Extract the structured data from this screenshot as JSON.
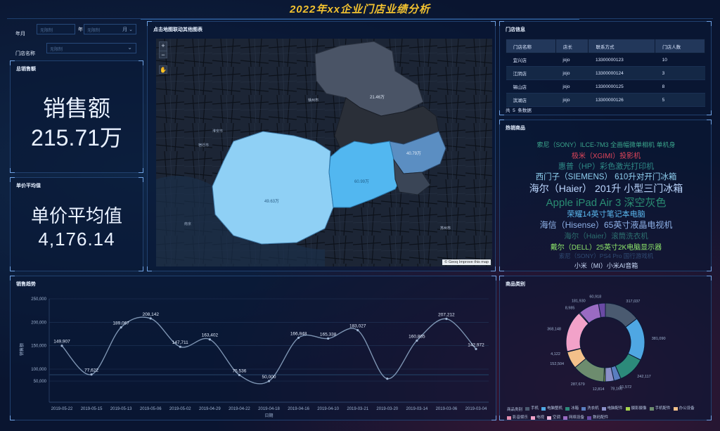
{
  "header": {
    "title": "2022年xx企业门店业绩分析"
  },
  "filters": {
    "year_label": "年月",
    "year_placeholder": "无限制",
    "year_suffix": "年",
    "month_placeholder": "无限制",
    "month_suffix": "月",
    "store_label": "门店名称",
    "store_placeholder": "无限制"
  },
  "kpi_sales": {
    "title": "总销售额",
    "label": "销售额",
    "value": "215.71万"
  },
  "kpi_price": {
    "title": "单价平均值",
    "label": "单价平均值",
    "value": "4,176.14"
  },
  "map": {
    "title": "点击地图联动其他图表",
    "zoom_in": "+",
    "zoom_out": "−",
    "attribution": "© Geoq Improve this map",
    "region_labels": [
      "21.46万",
      "40.79万",
      "49.63万",
      "60.99万"
    ],
    "place_labels": [
      "徐州市",
      "宿迁市",
      "淮安市",
      "盐城市",
      "常州市",
      "苏州市",
      "连云港",
      "扬州",
      "南京",
      "镇江",
      "无锡",
      "泰州",
      "南通"
    ]
  },
  "store_info": {
    "title": "门店信息",
    "columns": [
      "门店名称",
      "店长",
      "联系方式",
      "门店人数"
    ],
    "rows": [
      [
        "宜兴店",
        "jojo",
        "13300000123",
        "10"
      ],
      [
        "江阴店",
        "jojo",
        "13300000124",
        "3"
      ],
      [
        "锡山店",
        "jojo",
        "13300000125",
        "8"
      ],
      [
        "滨湖店",
        "jojo",
        "13300000126",
        "5"
      ]
    ],
    "footer_prefix": "共",
    "footer_count": "5",
    "footer_suffix": "条数据"
  },
  "hot": {
    "title": "热销商品",
    "words": [
      {
        "text": "索尼（SONY）ILCE-7M3 全画幅微单相机 单机身",
        "color": "#3aa58c",
        "size": 9
      },
      {
        "text": "极米（XGIMI）投影机",
        "color": "#e0455a",
        "size": 10
      },
      {
        "text": "惠普（HP）彩色激光打印机",
        "color": "#2e8b87",
        "size": 11
      },
      {
        "text": "西门子（SIEMENS） 610升对开门冰箱",
        "color": "#8fd0f0",
        "size": 11.5
      },
      {
        "text": "海尔（Haier） 201升 小型三门冰箱",
        "color": "#bcd7ff",
        "size": 14
      },
      {
        "text": "Apple iPad Air 3 深空灰色",
        "color": "#2a8d73",
        "size": 15
      },
      {
        "text": "荣耀14英寸笔记本电脑",
        "color": "#5bb8ef",
        "size": 11
      },
      {
        "text": "海信（Hisense）65英寸液晶电视机",
        "color": "#8fb2e8",
        "size": 12
      },
      {
        "text": "海尔（Haier）滚筒洗衣机",
        "color": "#2c6f6f",
        "size": 10.5
      },
      {
        "text": "戴尔（DELL）25英寸2K电脑显示器",
        "color": "#8ee86b",
        "size": 10
      },
      {
        "text": "索尼（SONY）PS4 Pro 国行游戏机",
        "color": "#2f4a72",
        "size": 8.5
      },
      {
        "text": "小米（MI）小米AI音箱",
        "color": "#c7d7f5",
        "size": 9
      }
    ]
  },
  "trend": {
    "title": "销售趋势",
    "ylabel": "销售额",
    "xlabel": "日期"
  },
  "chart_data": [
    {
      "type": "line",
      "title": "销售趋势",
      "xlabel": "日期",
      "ylabel": "销售额",
      "x": [
        "2019-05-22",
        "2019-05-15",
        "2019-05-13",
        "2019-05-06",
        "2019-05-02",
        "2019-04-29",
        "2019-04-22",
        "2019-04-18",
        "2019-04-16",
        "2019-04-10",
        "2019-03-21",
        "2019-03-20",
        "2019-03-14",
        "2019-03-06",
        "2019-03-04"
      ],
      "values": [
        149907,
        77622,
        189067,
        208142,
        147711,
        163402,
        75536,
        50000,
        166848,
        165338,
        183027,
        60000,
        160865,
        207212,
        142972
      ],
      "labels": [
        "149,907",
        "77,622",
        "189,067",
        "208,142",
        "147,711",
        "163,402",
        "75,536",
        "50,000",
        "166,848",
        "165,338",
        "183,027",
        "",
        "160,865",
        "207,212",
        "142,972"
      ],
      "yticks_top": [
        100000,
        150000,
        200000,
        250000
      ],
      "yticks_top_labels": [
        "100,000",
        "150,000",
        "200,000",
        "250,000"
      ],
      "yticks_bottom_labels": [
        "50,000",
        "0"
      ],
      "ylim": [
        0,
        250000
      ]
    },
    {
      "type": "pie",
      "title": "商品类别",
      "legend_title": "商品类别",
      "categories": [
        "手机",
        "电脑整机",
        "冰箱",
        "洗衣机",
        "电脑配件",
        "摄影摄像",
        "手机配件",
        "办公设备",
        "影音娱乐",
        "电视",
        "空调",
        "网络设备",
        "数码配件"
      ],
      "colors": [
        "#4a5a70",
        "#4fa7e3",
        "#2c8a7a",
        "#5a7ec0",
        "#8b8fc8",
        "#a6d24e",
        "#6d8c6e",
        "#f3c08a",
        "#e38cae",
        "#f2a2c9",
        "#e9b4d9",
        "#9a6bc2",
        "#6a4aa5"
      ],
      "values": [
        317037,
        381090,
        242117,
        61572,
        78166,
        12814,
        287679,
        152504,
        4122,
        368148,
        8985,
        181930,
        60918
      ],
      "labels": [
        "317,037",
        "381,090",
        "242,117",
        "61,572",
        "78,166",
        "12,814",
        "287,679",
        "152,504",
        "4,122",
        "368,148",
        "8,985",
        "181,930",
        "60,918"
      ]
    }
  ],
  "category_panel": {
    "title": "商品类别"
  }
}
